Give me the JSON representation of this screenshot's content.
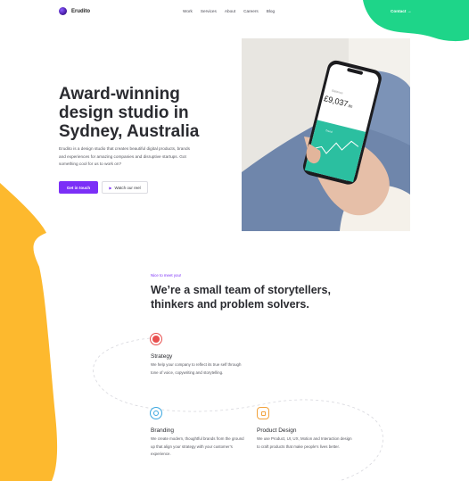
{
  "header": {
    "logo_text": "Erudito",
    "nav": [
      "Work",
      "Services",
      "About",
      "Careers",
      "Blog"
    ],
    "contact_label": "Contact →"
  },
  "hero": {
    "title": "Award-winning design studio in Sydney, Australia",
    "description": "Erudito is a design studio that creates beautiful digital products, brands and experiences for amazing companies and disruptive startups. Got something cool for us to work on?",
    "primary_button": "Get in touch",
    "secondary_button": "Watch our reel",
    "phone": {
      "label": "Balance",
      "amount": "£9,037",
      "amount_decimals": ".80",
      "chart_label": "Trend"
    }
  },
  "team": {
    "eyebrow": "Nice to meet you!",
    "title": "We’re a small team of storytellers, thinkers and problem solvers."
  },
  "services": [
    {
      "title": "Strategy",
      "text": "We help your company to reflect its true self through tone of voice, copywriting and storytelling.",
      "icon": "strategy-icon",
      "color": "#e8504f"
    },
    {
      "title": "Branding",
      "text": "We create modern, thoughtful brands from the ground up that align your strategy with your customer’s experience.",
      "icon": "branding-icon",
      "color": "#3aa7e0"
    },
    {
      "title": "Product Design",
      "text": "We use Product, UI, UX, Motion and Interaction design to craft products that make people’s lives better.",
      "icon": "product-design-icon",
      "color": "#f2a23c"
    }
  ],
  "colors": {
    "accent": "#7b2ff7",
    "green_blob": "#1ed589",
    "orange_blob": "#fdb92e"
  }
}
